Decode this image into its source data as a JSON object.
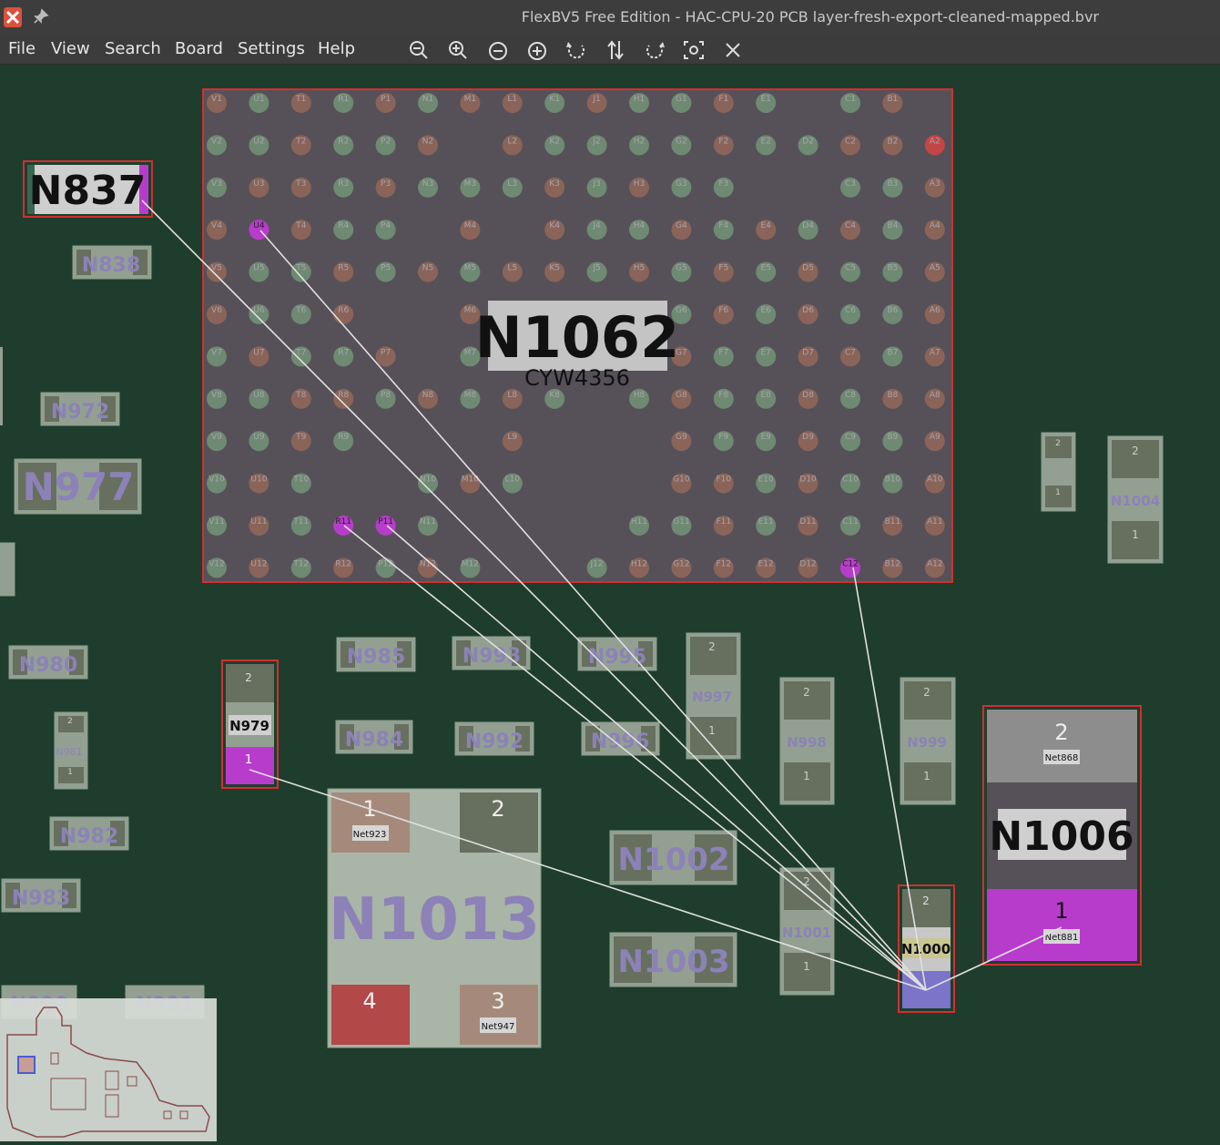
{
  "window": {
    "title": "FlexBV5 Free Edition - HAC-CPU-20 PCB layer-fresh-export-cleaned-mapped.bvr"
  },
  "menu": [
    "File",
    "View",
    "Search",
    "Board",
    "Settings",
    "Help"
  ],
  "toolbar": [
    {
      "icon": "zoom-out-icon"
    },
    {
      "icon": "zoom-in-icon"
    },
    {
      "icon": "minus-circle-icon"
    },
    {
      "icon": "plus-circle-icon"
    },
    {
      "icon": "rotate-ccw-icon"
    },
    {
      "icon": "flip-icon"
    },
    {
      "icon": "rotate-cw-icon"
    },
    {
      "icon": "fit-view-icon"
    },
    {
      "icon": "close-icon"
    }
  ],
  "colors": {
    "board": "#1f3d2c",
    "highlight": "#b83ccc",
    "selected_outline": "#d03030",
    "pin_green": "#6e8a72",
    "pin_brown": "#8a6458",
    "part_fill": "#565158"
  },
  "bga": {
    "name": "N1062",
    "value": "CYW4356",
    "cols": [
      "V",
      "U",
      "T",
      "R",
      "P",
      "N",
      "M",
      "L",
      "K",
      "J",
      "H",
      "G",
      "F",
      "E",
      "D",
      "C",
      "B",
      "A"
    ],
    "rows": 12,
    "missing": [
      "D1",
      "A1",
      "M2",
      "N4",
      "L4",
      "D3",
      "E3",
      "P6",
      "N6",
      "L6",
      "K6",
      "J6",
      "H6",
      "N7",
      "L7",
      "K7",
      "J7",
      "H7",
      "J8",
      "P9",
      "N9",
      "M9",
      "K9",
      "J9",
      "H9",
      "H10",
      "J10",
      "K10",
      "R10",
      "P10",
      "M11",
      "L11",
      "K11",
      "J11",
      "L12",
      "K12"
    ],
    "highlighted": [
      "U4",
      "R11",
      "P11",
      "C12"
    ],
    "red": [
      "A2"
    ],
    "color_map": "0101010010110101001101101011110110011001011101011001100101100101101010100110101001010101100110110100110101101011001001101100101100101010101101001101011001001101101010110101100101101010011010110101001010101101"
  },
  "parts": {
    "n837": "N837",
    "n838": "N838",
    "n972": "N972",
    "n977": "N977",
    "n980": "N980",
    "n981": "N981",
    "n982": "N982",
    "n983": "N983",
    "n979": "N979",
    "n985": "N985",
    "n984": "N984",
    "n993": "N993",
    "n992": "N992",
    "n995": "N995",
    "n996": "N996",
    "n997": "N997",
    "n998": "N998",
    "n999": "N999",
    "n1001": "N1001",
    "n1002": "N1002",
    "n1003": "N1003",
    "n1004": "N1004",
    "n1000": "N1000",
    "n1006": "N1006",
    "n1013": "N1013",
    "n990": "N990",
    "n991": "N991"
  },
  "pads": {
    "p1": "1",
    "p2": "2",
    "p3": "3",
    "p4": "4"
  },
  "nets": {
    "n1006_top": "Net868",
    "n1006_bot": "Net881",
    "n1013_p1": "Net923",
    "n1013_p3": "Net947"
  }
}
